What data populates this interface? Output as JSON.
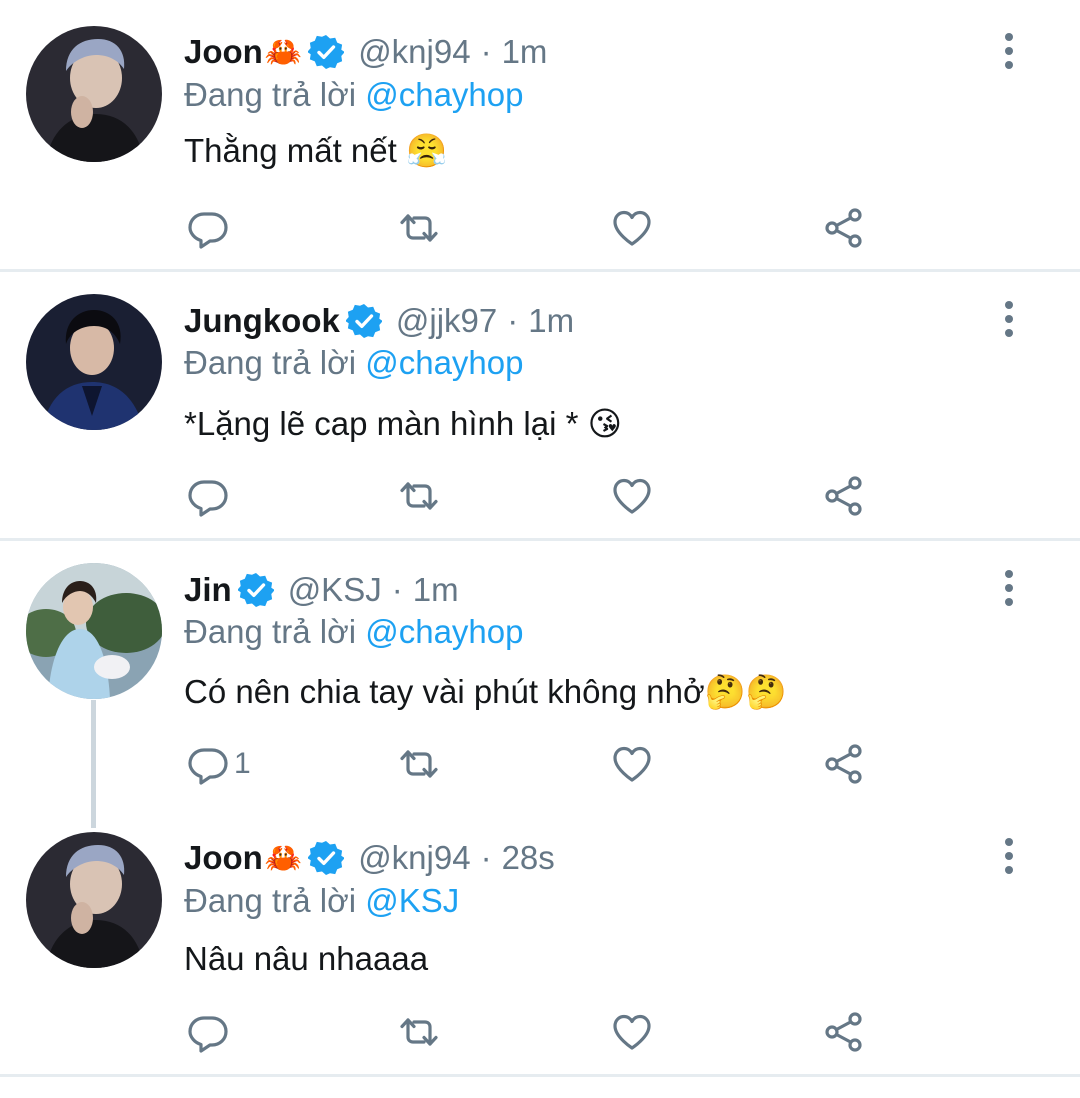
{
  "tweets": [
    {
      "name": "Joon",
      "name_emoji": "🦀",
      "handle": "@knj94",
      "time": "1m",
      "reply_prefix": "Đang trả lời",
      "reply_to": "@chayhop",
      "text": "Thằng mất nết 😤",
      "reply_count": "",
      "avatar_color": "#2b2a33"
    },
    {
      "name": "Jungkook",
      "name_emoji": "",
      "handle": "@jjk97",
      "time": "1m",
      "reply_prefix": "Đang trả lời",
      "reply_to": "@chayhop",
      "text": "*Lặng lẽ cap màn hình lại * 😘",
      "reply_count": "",
      "avatar_color": "#1c2440"
    },
    {
      "name": "Jin",
      "name_emoji": "",
      "handle": "@KSJ",
      "time": "1m",
      "reply_prefix": "Đang trả lời",
      "reply_to": "@chayhop",
      "text": "Có nên chia tay vài phút không nhở🤔🤔",
      "reply_count": "1",
      "avatar_color": "#6e8f6a"
    },
    {
      "name": "Joon",
      "name_emoji": "🦀",
      "handle": "@knj94",
      "time": "28s",
      "reply_prefix": "Đang trả lời",
      "reply_to": "@KSJ",
      "text": " Nâu nâu nhaaaa",
      "reply_count": "",
      "avatar_color": "#2b2a33"
    }
  ],
  "separator": "·",
  "colors": {
    "accent": "#1da1f2",
    "secondary_text": "#657786",
    "primary_text": "#14171a",
    "divider": "#e6ecf0"
  },
  "icons": [
    "reply-icon",
    "retweet-icon",
    "like-icon",
    "share-icon",
    "more-options-icon",
    "verified-badge-icon"
  ]
}
